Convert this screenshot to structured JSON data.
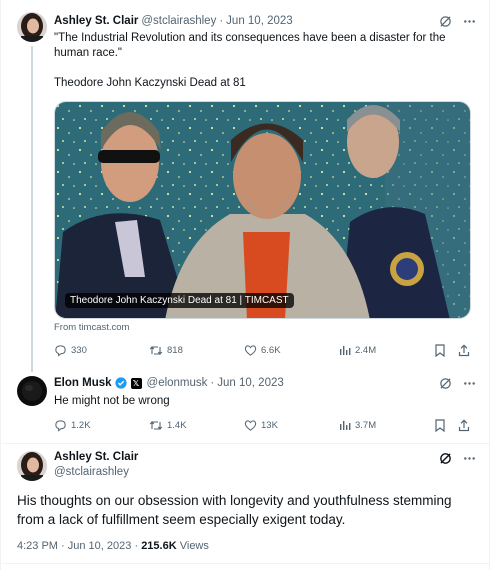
{
  "colors": {
    "text": "#0f1419",
    "muted": "#536471",
    "border": "#eff3f4",
    "verified": "#1d9bf0"
  },
  "tweet1": {
    "name": "Ashley St. Clair",
    "handle": "@stclairashley",
    "date": "Jun 10, 2023",
    "line1": "\"The Industrial Revolution and its consequences have been a disaster for the",
    "line2": "human race.\"",
    "line3": "Theodore John Kaczynski Dead at 81",
    "card_caption": "Theodore John Kaczynski Dead at 81 | TIMCAST",
    "card_source": "From timcast.com",
    "stats": {
      "replies": "330",
      "reposts": "818",
      "likes": "6.6K",
      "views": "2.4M"
    }
  },
  "tweet2": {
    "name": "Elon Musk",
    "handle": "@elonmusk",
    "date": "Jun 10, 2023",
    "text": "He might not be wrong",
    "stats": {
      "replies": "1.2K",
      "reposts": "1.4K",
      "likes": "13K",
      "views": "3.7M"
    }
  },
  "main": {
    "name": "Ashley St. Clair",
    "handle": "@stclairashley",
    "line1": "His thoughts on our obsession with longevity and youthfulness stemming",
    "line2": "from a lack of fulfillment seem especially exigent today.",
    "time": "4:23 PM",
    "date": "Jun 10, 2023",
    "views_count": "215.6K",
    "views_label": "Views"
  },
  "icons": [
    "grok-icon",
    "more-icon",
    "reply-icon",
    "repost-icon",
    "like-icon",
    "views-icon",
    "bookmark-icon",
    "share-icon",
    "verified-badge-icon",
    "x-affiliate-icon"
  ]
}
